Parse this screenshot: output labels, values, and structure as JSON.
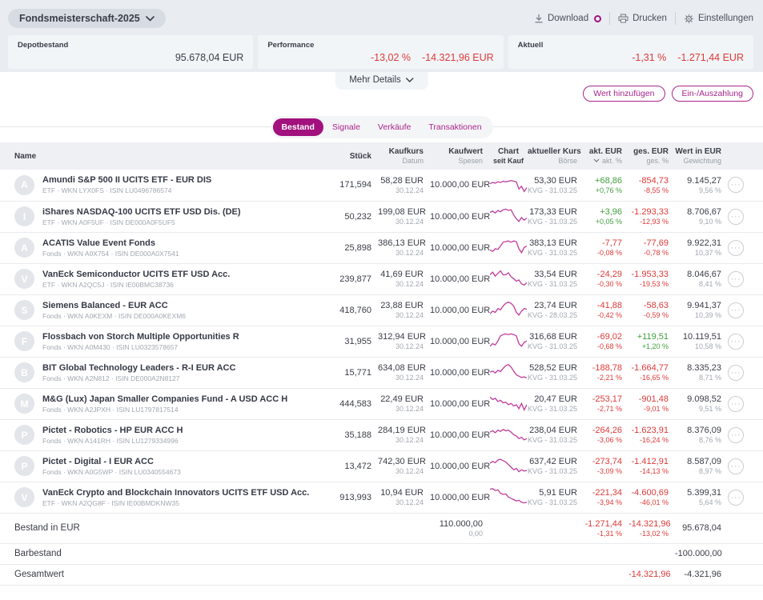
{
  "colors": {
    "accent": "#a2117e",
    "red": "#dc3b39",
    "green": "#3f9e3c",
    "spark": "#c03c9e"
  },
  "header": {
    "portfolio": "Fondsmeisterschaft-2025",
    "actions": {
      "download": "Download",
      "print": "Drucken",
      "settings": "Einstellungen"
    },
    "summary": [
      {
        "label": "Depotbestand",
        "values": [
          {
            "text": "95.678,04 EUR",
            "color": "dark"
          }
        ]
      },
      {
        "label": "Performance",
        "values": [
          {
            "text": "-13,02 %",
            "color": "red"
          },
          {
            "text": "-14.321,96 EUR",
            "color": "red"
          }
        ]
      },
      {
        "label": "Aktuell",
        "values": [
          {
            "text": "-1,31 %",
            "color": "red"
          },
          {
            "text": "-1.271,44 EUR",
            "color": "red"
          }
        ]
      }
    ],
    "mehr_details": "Mehr Details"
  },
  "buttons": {
    "add_value": "Wert hinzufügen",
    "pay_in_out": "Ein-/Auszahlung"
  },
  "tabs": [
    {
      "label": "Bestand",
      "active": true
    },
    {
      "label": "Signale",
      "active": false
    },
    {
      "label": "Verkäufe",
      "active": false
    },
    {
      "label": "Transaktionen",
      "active": false
    }
  ],
  "table": {
    "columns": {
      "name": "Name",
      "stueck": "Stück",
      "kaufkurs": "Kaufkurs",
      "datum": "Datum",
      "kaufwert": "Kaufwert",
      "spesen": "Spesen",
      "chart": "Chart",
      "seit_kauf": "seit Kauf",
      "akt_kurs": "aktueller Kurs",
      "boerse": "Börse",
      "akt_eur": "akt. EUR",
      "akt_pct": "akt. %",
      "ges_eur": "ges. EUR",
      "ges_pct": "ges. %",
      "wert": "Wert in EUR",
      "gewichtung": "Gewichtung"
    },
    "rows": [
      {
        "letter": "A",
        "name": "Amundi S&P 500 II UCITS ETF - EUR DIS",
        "sub": "ETF · WKN LYX0FS · ISIN LU0496786574",
        "stueck": "171,594",
        "kaufkurs": "58,28 EUR",
        "datum": "30.12.24",
        "kaufwert": "10.000,00 EUR",
        "kurs": "53,30 EUR",
        "boerse": "KVG - 31.03.25",
        "akt_eur": "+68,86",
        "akt_pct": "+0,76 %",
        "akt_color": "green",
        "ges_eur": "-854,73",
        "ges_pct": "-8,55 %",
        "ges_color": "red",
        "wert": "9.145,27",
        "gewichtung": "9,56 %",
        "spark": [
          14,
          16,
          15,
          17,
          16,
          18,
          17,
          18,
          19,
          18,
          17,
          6,
          10,
          2,
          8
        ]
      },
      {
        "letter": "I",
        "name": "iShares NASDAQ-100 UCITS ETF USD Dis. (DE)",
        "sub": "ETF · WKN A0F5UF · ISIN DE000A0F5UF5",
        "stueck": "50,232",
        "kaufkurs": "199,08 EUR",
        "datum": "30.12.24",
        "kaufwert": "10.000,00 EUR",
        "kurs": "173,33 EUR",
        "boerse": "KVG - 31.03.25",
        "akt_eur": "+3,96",
        "akt_pct": "+0,05 %",
        "akt_color": "green",
        "ges_eur": "-1.293,33",
        "ges_pct": "-12,93 %",
        "ges_color": "red",
        "wert": "8.706,67",
        "gewichtung": "9,10 %",
        "spark": [
          18,
          20,
          17,
          21,
          19,
          22,
          23,
          21,
          22,
          14,
          8,
          4,
          10,
          6,
          9
        ]
      },
      {
        "letter": "A",
        "name": "ACATIS Value Event Fonds",
        "sub": "Fonds · WKN A0X754 · ISIN DE000A0X7541",
        "stueck": "25,898",
        "kaufkurs": "386,13 EUR",
        "datum": "30.12.24",
        "kaufwert": "10.000,00 EUR",
        "kurs": "383,13 EUR",
        "boerse": "KVG - 31.03.25",
        "akt_eur": "-7,77",
        "akt_pct": "-0,08 %",
        "akt_color": "red",
        "ges_eur": "-77,69",
        "ges_pct": "-0,78 %",
        "ges_color": "red",
        "wert": "9.922,31",
        "gewichtung": "10,37 %",
        "spark": [
          8,
          6,
          10,
          9,
          14,
          20,
          21,
          22,
          20,
          22,
          21,
          10,
          4,
          12,
          14
        ]
      },
      {
        "letter": "V",
        "name": "VanEck Semiconductor UCITS ETF USD Acc.",
        "sub": "ETF · WKN A2QC5J · ISIN IE00BMC38736",
        "stueck": "239,877",
        "kaufkurs": "41,69 EUR",
        "datum": "30.12.24",
        "kaufwert": "10.000,00 EUR",
        "kurs": "33,54 EUR",
        "boerse": "KVG - 31.03.25",
        "akt_eur": "-24,29",
        "akt_pct": "-0,30 %",
        "akt_color": "red",
        "ges_eur": "-1.953,33",
        "ges_pct": "-19,53 %",
        "ges_color": "red",
        "wert": "8.046,67",
        "gewichtung": "8,41 %",
        "spark": [
          18,
          22,
          16,
          20,
          24,
          18,
          18,
          21,
          15,
          12,
          8,
          10,
          4,
          2,
          6
        ]
      },
      {
        "letter": "S",
        "name": "Siemens Balanced - EUR ACC",
        "sub": "Fonds · WKN A0KEXM · ISIN DE000A0KEXM6",
        "stueck": "418,760",
        "kaufkurs": "23,88 EUR",
        "datum": "30.12.24",
        "kaufwert": "10.000,00 EUR",
        "kurs": "23,74 EUR",
        "boerse": "KVG - 28.03.25",
        "akt_eur": "-41,88",
        "akt_pct": "-0,42 %",
        "akt_color": "red",
        "ges_eur": "-58,63",
        "ges_pct": "-0,59 %",
        "ges_color": "red",
        "wert": "9.941,37",
        "gewichtung": "10,39 %",
        "spark": [
          6,
          10,
          8,
          14,
          12,
          18,
          22,
          24,
          22,
          18,
          8,
          4,
          10,
          14,
          13
        ]
      },
      {
        "letter": "F",
        "name": "Flossbach von Storch Multiple Opportunities R",
        "sub": "Fonds · WKN A0M430 · ISIN LU0323578657",
        "stueck": "31,955",
        "kaufkurs": "312,94 EUR",
        "datum": "30.12.24",
        "kaufwert": "10.000,00 EUR",
        "kurs": "316,68 EUR",
        "boerse": "KVG - 31.03.25",
        "akt_eur": "-69,02",
        "akt_pct": "-0,68 %",
        "akt_color": "red",
        "ges_eur": "+119,51",
        "ges_pct": "+1,20 %",
        "ges_color": "green",
        "wert": "10.119,51",
        "gewichtung": "10,58 %",
        "spark": [
          4,
          8,
          6,
          12,
          20,
          22,
          23,
          22,
          23,
          22,
          20,
          8,
          4,
          10,
          12
        ]
      },
      {
        "letter": "B",
        "name": "BIT Global Technology Leaders - R-I EUR ACC",
        "sub": "Fonds · WKN A2N812 · ISIN DE000A2N8127",
        "stueck": "15,771",
        "kaufkurs": "634,08 EUR",
        "datum": "30.12.24",
        "kaufwert": "10.000,00 EUR",
        "kurs": "528,52 EUR",
        "boerse": "KVG - 31.03.25",
        "akt_eur": "-188,78",
        "akt_pct": "-2,21 %",
        "akt_color": "red",
        "ges_eur": "-1.664,77",
        "ges_pct": "-16,65 %",
        "ges_color": "red",
        "wert": "8.335,23",
        "gewichtung": "8,71 %",
        "spark": [
          12,
          14,
          11,
          15,
          13,
          18,
          22,
          24,
          20,
          14,
          8,
          6,
          4,
          5,
          3
        ]
      },
      {
        "letter": "M",
        "name": "M&G (Lux) Japan Smaller Companies Fund - A USD ACC H",
        "sub": "Fonds · WKN A2JPXH · ISIN LU1797817514",
        "stueck": "444,583",
        "kaufkurs": "22,49 EUR",
        "datum": "30.12.24",
        "kaufwert": "10.000,00 EUR",
        "kurs": "20,47 EUR",
        "boerse": "KVG - 31.03.25",
        "akt_eur": "-253,17",
        "akt_pct": "-2,71 %",
        "akt_color": "red",
        "ges_eur": "-901,48",
        "ges_pct": "-9,01 %",
        "ges_color": "red",
        "wert": "9.098,52",
        "gewichtung": "9,51 %",
        "spark": [
          22,
          18,
          20,
          15,
          17,
          13,
          14,
          10,
          12,
          8,
          10,
          4,
          12,
          2,
          10
        ]
      },
      {
        "letter": "P",
        "name": "Pictet - Robotics - HP EUR ACC H",
        "sub": "Fonds · WKN A141RH · ISIN LU1279334996",
        "stueck": "35,188",
        "kaufkurs": "284,19 EUR",
        "datum": "30.12.24",
        "kaufwert": "10.000,00 EUR",
        "kurs": "238,04 EUR",
        "boerse": "KVG - 31.03.25",
        "akt_eur": "-264,26",
        "akt_pct": "-3,06 %",
        "akt_color": "red",
        "ges_eur": "-1.623,91",
        "ges_pct": "-16,24 %",
        "ges_color": "red",
        "wert": "8.376,09",
        "gewichtung": "8,76 %",
        "spark": [
          16,
          18,
          15,
          19,
          17,
          20,
          18,
          19,
          16,
          12,
          10,
          6,
          8,
          4,
          6
        ]
      },
      {
        "letter": "P",
        "name": "Pictet - Digital - I EUR ACC",
        "sub": "Fonds · WKN A0G5WP · ISIN LU0340554673",
        "stueck": "13,472",
        "kaufkurs": "742,30 EUR",
        "datum": "30.12.24",
        "kaufwert": "10.000,00 EUR",
        "kurs": "637,42 EUR",
        "boerse": "KVG - 31.03.25",
        "akt_eur": "-273,74",
        "akt_pct": "-3,09 %",
        "akt_color": "red",
        "ges_eur": "-1.412,91",
        "ges_pct": "-14,13 %",
        "ges_color": "red",
        "wert": "8.587,09",
        "gewichtung": "8,97 %",
        "spark": [
          16,
          19,
          17,
          21,
          22,
          20,
          18,
          14,
          10,
          6,
          8,
          3,
          6,
          4,
          5
        ]
      },
      {
        "letter": "V",
        "name": "VanEck Crypto and Blockchain Innovators UCITS ETF USD Acc.",
        "sub": "ETF · WKN A2QG8F · ISIN IE00BMDKNW35",
        "stueck": "913,993",
        "kaufkurs": "10,94 EUR",
        "datum": "30.12.24",
        "kaufwert": "10.000,00 EUR",
        "kurs": "5,91 EUR",
        "boerse": "KVG - 31.03.25",
        "akt_eur": "-221,34",
        "akt_pct": "-3,94 %",
        "akt_color": "red",
        "ges_eur": "-4.600,69",
        "ges_pct": "-46,01 %",
        "ges_color": "red",
        "wert": "5.399,31",
        "gewichtung": "5,64 %",
        "spark": [
          24,
          25,
          22,
          23,
          18,
          16,
          17,
          12,
          10,
          8,
          6,
          7,
          4,
          3,
          4
        ]
      }
    ],
    "footer": [
      {
        "label": "Bestand in EUR",
        "kaufwert": "110.000,00",
        "spesen": "0,00",
        "akt_eur": "-1.271,44",
        "akt_pct": "-1,31 %",
        "akt_color": "red",
        "ges_eur": "-14.321,96",
        "ges_pct": "-13,02 %",
        "ges_color": "red",
        "wert": "95.678,04",
        "main": true
      },
      {
        "label": "Barbestand",
        "wert": "-100.000,00",
        "main": false
      },
      {
        "label": "Gesamtwert",
        "ges_eur": "-14.321,96",
        "ges_color": "red",
        "wert": "-4.321,96",
        "main": false
      }
    ]
  }
}
